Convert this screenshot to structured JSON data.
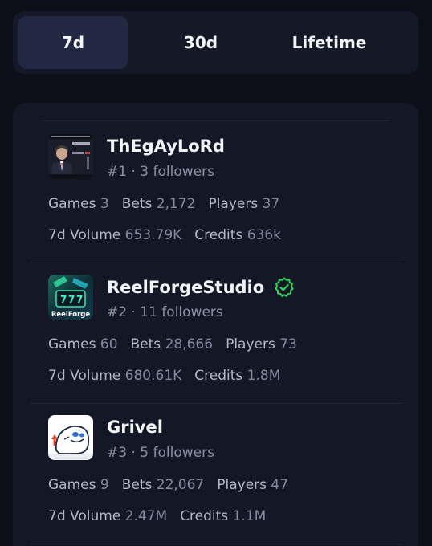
{
  "tabs": [
    "7d",
    "30d",
    "Lifetime"
  ],
  "active_tab": "7d",
  "entries": [
    {
      "name": "ThEgAyLoRd",
      "rank": "#1",
      "followers": "3 followers",
      "verified": false,
      "avatar_icon": "political-poster-avatar",
      "games_label": "Games",
      "games": "3",
      "bets_label": "Bets",
      "bets": "2,172",
      "players_label": "Players",
      "players": "37",
      "volume_label": "7d Volume",
      "volume": "653.79K",
      "credits_label": "Credits",
      "credits": "636k"
    },
    {
      "name": "ReelForgeStudio",
      "rank": "#2",
      "followers": "11 followers",
      "verified": true,
      "avatar_icon": "reelforge-logo-avatar",
      "avatar_text": "ReelForge",
      "games_label": "Games",
      "games": "60",
      "bets_label": "Bets",
      "bets": "28,666",
      "players_label": "Players",
      "players": "73",
      "volume_label": "7d Volume",
      "volume": "680.61K",
      "credits_label": "Credits",
      "credits": "1.8M"
    },
    {
      "name": "Grivel",
      "rank": "#3",
      "followers": "5 followers",
      "verified": false,
      "avatar_icon": "cartoon-blob-avatar",
      "games_label": "Games",
      "games": "9",
      "bets_label": "Bets",
      "bets": "22,067",
      "players_label": "Players",
      "players": "47",
      "volume_label": "7d Volume",
      "volume": "2.47M",
      "credits_label": "Credits",
      "credits": "1.1M"
    }
  ],
  "colors": {
    "background": "#0c0e18",
    "card": "#141726",
    "active_tab": "#232842",
    "verified_green": "#2bd65a"
  }
}
